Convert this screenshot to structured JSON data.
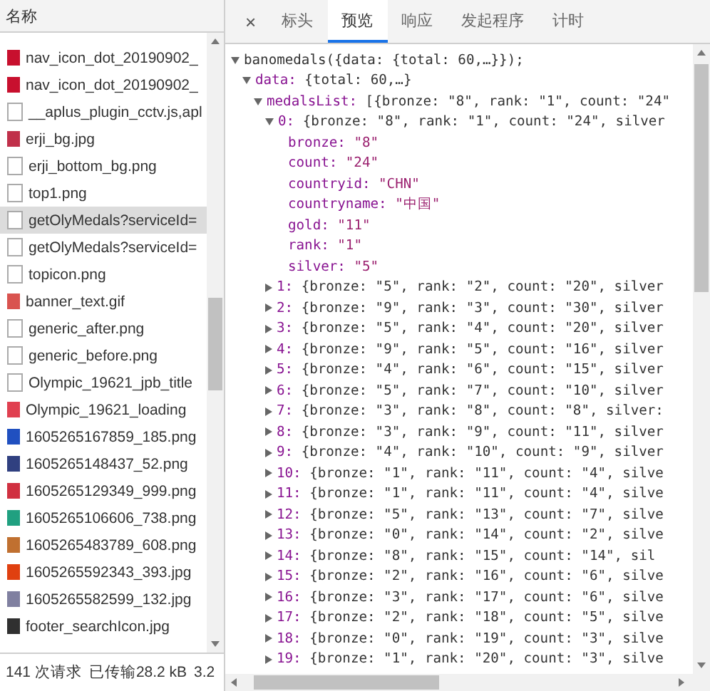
{
  "requests": {
    "header": "名称",
    "items": [
      {
        "name": "nav_icon_dot_20190902_",
        "kind": "image",
        "color": "#c8102e",
        "selected": false
      },
      {
        "name": "nav_icon_dot_20190902_",
        "kind": "image",
        "color": "#c8102e",
        "selected": false
      },
      {
        "name": "__aplus_plugin_cctv.js,apl",
        "kind": "doc",
        "selected": false
      },
      {
        "name": "erji_bg.jpg",
        "kind": "image",
        "color": "#c0304a",
        "selected": false
      },
      {
        "name": "erji_bottom_bg.png",
        "kind": "doc",
        "selected": false
      },
      {
        "name": "top1.png",
        "kind": "doc",
        "selected": false
      },
      {
        "name": "getOlyMedals?serviceId=",
        "kind": "doc",
        "selected": true
      },
      {
        "name": "getOlyMedals?serviceId=",
        "kind": "doc",
        "selected": false
      },
      {
        "name": "topicon.png",
        "kind": "doc",
        "selected": false
      },
      {
        "name": "banner_text.gif",
        "kind": "image",
        "color": "#d9534f",
        "selected": false
      },
      {
        "name": "generic_after.png",
        "kind": "doc",
        "selected": false
      },
      {
        "name": "generic_before.png",
        "kind": "doc",
        "selected": false
      },
      {
        "name": "Olympic_19621_jpb_title",
        "kind": "doc",
        "selected": false
      },
      {
        "name": "Olympic_19621_loading",
        "kind": "image",
        "color": "#e04050",
        "selected": false
      },
      {
        "name": "1605265167859_185.png",
        "kind": "image",
        "color": "#2050c0",
        "selected": false
      },
      {
        "name": "1605265148437_52.png",
        "kind": "image",
        "color": "#304080",
        "selected": false
      },
      {
        "name": "1605265129349_999.png",
        "kind": "image",
        "color": "#d03040",
        "selected": false
      },
      {
        "name": "1605265106606_738.png",
        "kind": "image",
        "color": "#20a080",
        "selected": false
      },
      {
        "name": "1605265483789_608.png",
        "kind": "image",
        "color": "#c07030",
        "selected": false
      },
      {
        "name": "1605265592343_393.jpg",
        "kind": "image",
        "color": "#e04010",
        "selected": false
      },
      {
        "name": "1605265582599_132.jpg",
        "kind": "image",
        "color": "#8080a0",
        "selected": false
      },
      {
        "name": "footer_searchIcon.jpg",
        "kind": "image",
        "color": "#303030",
        "selected": false
      }
    ],
    "status_bar": [
      "141 次请求",
      "已传输28.2 kB",
      "3.2"
    ]
  },
  "details": {
    "close": "×",
    "tabs": [
      {
        "label": "标头",
        "selected": false
      },
      {
        "label": "预览",
        "selected": true
      },
      {
        "label": "响应",
        "selected": false
      },
      {
        "label": "发起程序",
        "selected": false
      },
      {
        "label": "计时",
        "selected": false
      }
    ],
    "tree": [
      {
        "label": "banomedals({data: {total: 60,…}});",
        "expanded": true,
        "children": [
          {
            "key": "data:",
            "value": "{total: 60,…}",
            "expanded": true,
            "children": [
              {
                "key": "medalsList:",
                "value": "[{bronze: \"8\", rank: \"1\", count: \"24\"",
                "expanded": true,
                "children": [
                  {
                    "key": "0:",
                    "value": "{bronze: \"8\", rank: \"1\", count: \"24\", silver",
                    "expanded": true,
                    "children": [
                      {
                        "key": "bronze:",
                        "value": "\"8\""
                      },
                      {
                        "key": "count:",
                        "value": "\"24\""
                      },
                      {
                        "key": "countryid:",
                        "value": "\"CHN\""
                      },
                      {
                        "key": "countryname:",
                        "value": "\"中国\""
                      },
                      {
                        "key": "gold:",
                        "value": "\"11\""
                      },
                      {
                        "key": "rank:",
                        "value": "\"1\""
                      },
                      {
                        "key": "silver:",
                        "value": "\"5\""
                      }
                    ]
                  },
                  {
                    "key": "1:",
                    "value": "{bronze: \"5\", rank: \"2\", count: \"20\", silver",
                    "expanded": false
                  },
                  {
                    "key": "2:",
                    "value": "{bronze: \"9\", rank: \"3\", count: \"30\", silver",
                    "expanded": false
                  },
                  {
                    "key": "3:",
                    "value": "{bronze: \"5\", rank: \"4\", count: \"20\", silver",
                    "expanded": false
                  },
                  {
                    "key": "4:",
                    "value": "{bronze: \"9\", rank: \"5\", count: \"16\", silver",
                    "expanded": false
                  },
                  {
                    "key": "5:",
                    "value": "{bronze: \"4\", rank: \"6\", count: \"15\", silver",
                    "expanded": false
                  },
                  {
                    "key": "6:",
                    "value": "{bronze: \"5\", rank: \"7\", count: \"10\", silver",
                    "expanded": false
                  },
                  {
                    "key": "7:",
                    "value": "{bronze: \"3\", rank: \"8\", count: \"8\", silver:",
                    "expanded": false
                  },
                  {
                    "key": "8:",
                    "value": "{bronze: \"3\", rank: \"9\", count: \"11\", silver",
                    "expanded": false
                  },
                  {
                    "key": "9:",
                    "value": "{bronze: \"4\", rank: \"10\", count: \"9\", silver",
                    "expanded": false
                  },
                  {
                    "key": "10:",
                    "value": "{bronze: \"1\", rank: \"11\", count: \"4\", silve",
                    "expanded": false
                  },
                  {
                    "key": "11:",
                    "value": "{bronze: \"1\", rank: \"11\", count: \"4\", silve",
                    "expanded": false
                  },
                  {
                    "key": "12:",
                    "value": "{bronze: \"5\", rank: \"13\", count: \"7\", silve",
                    "expanded": false
                  },
                  {
                    "key": "13:",
                    "value": "{bronze: \"0\", rank: \"14\", count: \"2\", silve",
                    "expanded": false
                  },
                  {
                    "key": "14:",
                    "value": "{bronze: \"8\", rank: \"15\", count: \"14\", sil",
                    "expanded": false
                  },
                  {
                    "key": "15:",
                    "value": "{bronze: \"2\", rank: \"16\", count: \"6\", silve",
                    "expanded": false
                  },
                  {
                    "key": "16:",
                    "value": "{bronze: \"3\", rank: \"17\", count: \"6\", silve",
                    "expanded": false
                  },
                  {
                    "key": "17:",
                    "value": "{bronze: \"2\", rank: \"18\", count: \"5\", silve",
                    "expanded": false
                  },
                  {
                    "key": "18:",
                    "value": "{bronze: \"0\", rank: \"19\", count: \"3\", silve",
                    "expanded": false
                  },
                  {
                    "key": "19:",
                    "value": "{bronze: \"1\", rank: \"20\", count: \"3\", silve",
                    "expanded": false
                  }
                ]
              }
            ]
          }
        ]
      }
    ]
  }
}
